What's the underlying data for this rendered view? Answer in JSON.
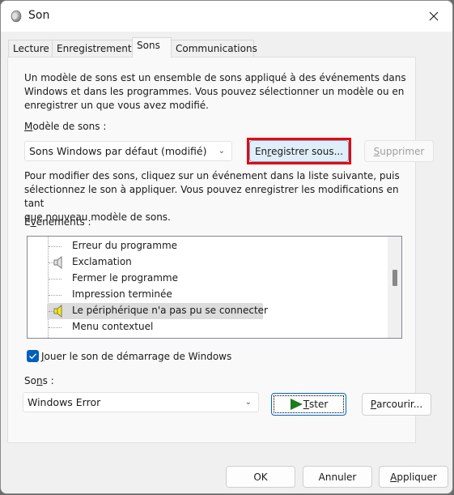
{
  "window": {
    "title": "Son",
    "icon": "speaker-icon",
    "close_icon": "close-icon"
  },
  "tabs": [
    {
      "label": "Lecture",
      "active": false
    },
    {
      "label": "Enregistrement",
      "active": false
    },
    {
      "label": "Sons",
      "active": true
    },
    {
      "label": "Communications",
      "active": false
    }
  ],
  "sons_tab": {
    "intro_line1": "Un modèle de sons est un ensemble de sons appliqué à des événements dans",
    "intro_line2": "Windows et dans les programmes. Vous pouvez sélectionner un modèle ou en",
    "intro_line3": "enregistrer un que vous avez modifié.",
    "scheme_label_hotkey": "M",
    "scheme_label_rest": "odèle de sons :",
    "scheme_value": "Sons Windows par défaut (modifié)",
    "save_as_pre": "En",
    "save_as_hotkey": "r",
    "save_as_post": "egistrer sous...",
    "delete_hotkey": "S",
    "delete_rest": "upprimer",
    "delete_disabled": true,
    "modify_line1": "Pour modifier des sons, cliquez sur un événement dans la liste suivante, puis",
    "modify_line2": "sélectionnez le son à appliquer. Vous pouvez enregistrer les modifications en tant",
    "modify_line3": "que nouveau modèle de sons.",
    "events_label_pre": "É",
    "events_label_hotkey": "v",
    "events_label_post": "énements :",
    "events": [
      {
        "label": "Erreur du programme",
        "has_sound": false,
        "selected": false
      },
      {
        "label": "Exclamation",
        "has_sound": true,
        "selected": false
      },
      {
        "label": "Fermer le programme",
        "has_sound": false,
        "selected": false
      },
      {
        "label": "Impression terminée",
        "has_sound": false,
        "selected": false
      },
      {
        "label": "Le périphérique n'a pas pu se connecter",
        "has_sound": true,
        "selected": true
      },
      {
        "label": "Menu contextuel",
        "has_sound": false,
        "selected": false
      }
    ],
    "startup_checkbox_hotkey": "J",
    "startup_checkbox_rest": "ouer le son de démarrage de Windows",
    "startup_checked": true,
    "sounds_label_pre": "So",
    "sounds_label_hotkey": "n",
    "sounds_label_post": "s :",
    "sound_value": "Windows Error",
    "test_pre": "",
    "test_hotkey": "T",
    "test_post_e": "e",
    "test_rest": "ster",
    "browse_hotkey": "P",
    "browse_rest": "arcourir..."
  },
  "footer": {
    "ok": "OK",
    "cancel": "Annuler",
    "apply_hotkey": "A",
    "apply_rest": "ppliquer"
  },
  "colors": {
    "highlight_border": "#e8000b",
    "accent": "#005fb8",
    "play_green": "#1e7a1e"
  }
}
